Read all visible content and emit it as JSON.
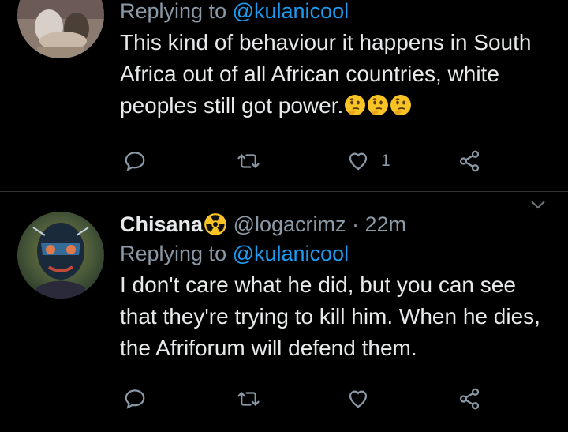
{
  "tweets": [
    {
      "replying_prefix": "Replying to ",
      "replying_to": "@kulanicool",
      "text": "This kind of behaviour it happens in South Africa out of all African countries, white peoples still got power.",
      "emojis": [
        "thinking-face-emoji",
        "thinking-face-emoji",
        "thinking-face-emoji"
      ],
      "like_count": "1"
    },
    {
      "name": "Chisana",
      "name_emoji": "radioactive-emoji",
      "handle": "@logacrimz",
      "separator": " · ",
      "time": "22m",
      "replying_prefix": "Replying to ",
      "replying_to": "@kulanicool",
      "text": "I don't care what he did, but you can see that they're trying to kill him. When he dies, the Afriforum will defend them.",
      "like_count": ""
    }
  ],
  "icons": {
    "reply": "reply-icon",
    "retweet": "retweet-icon",
    "like": "like-icon",
    "share": "share-icon",
    "menu": "chevron-down-icon"
  },
  "colors": {
    "background": "#000000",
    "text": "#e7e9ea",
    "secondary": "#8b98a5",
    "mention": "#1d9bf0",
    "divider": "#2f3336"
  }
}
